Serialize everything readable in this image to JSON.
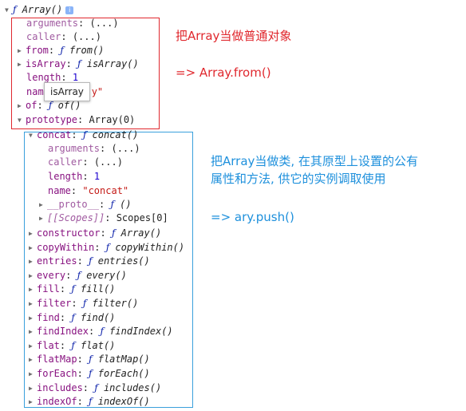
{
  "colors": {
    "red_annotation": "#e0282e",
    "blue_annotation": "#1e90dc",
    "key": "#881280",
    "func": "#0d22aa",
    "number": "#1c00cf",
    "string": "#c41a16"
  },
  "root": {
    "f": "ƒ",
    "name": "Array()",
    "info_icon": "i"
  },
  "red_group": {
    "arguments": {
      "key": "arguments",
      "value": "(...)"
    },
    "caller": {
      "key": "caller",
      "value": "(...)"
    },
    "from": {
      "key": "from",
      "f": "ƒ",
      "value": "from()"
    },
    "isArray": {
      "key": "isArray",
      "f": "ƒ",
      "value": "isArray()"
    },
    "length": {
      "key": "length",
      "value": "1"
    },
    "name": {
      "key": "nam",
      "value": "y\""
    },
    "of": {
      "key": "of",
      "f": "ƒ",
      "value": "of()"
    },
    "prototype": {
      "key": "prototype",
      "value": "Array(0)"
    }
  },
  "tooltip": "isArray",
  "concat": {
    "key": "concat",
    "f": "ƒ",
    "value": "concat()",
    "arguments": {
      "key": "arguments",
      "value": "(...)"
    },
    "caller": {
      "key": "caller",
      "value": "(...)"
    },
    "length": {
      "key": "length",
      "value": "1"
    },
    "name": {
      "key": "name",
      "value": "\"concat\""
    },
    "proto": {
      "key": "__proto__",
      "f": "ƒ",
      "value": "()"
    },
    "scopes": {
      "key": "[[Scopes]]",
      "value": "Scopes[0]"
    }
  },
  "methods": [
    {
      "key": "constructor",
      "f": "ƒ",
      "value": "Array()"
    },
    {
      "key": "copyWithin",
      "f": "ƒ",
      "value": "copyWithin()"
    },
    {
      "key": "entries",
      "f": "ƒ",
      "value": "entries()"
    },
    {
      "key": "every",
      "f": "ƒ",
      "value": "every()"
    },
    {
      "key": "fill",
      "f": "ƒ",
      "value": "fill()"
    },
    {
      "key": "filter",
      "f": "ƒ",
      "value": "filter()"
    },
    {
      "key": "find",
      "f": "ƒ",
      "value": "find()"
    },
    {
      "key": "findIndex",
      "f": "ƒ",
      "value": "findIndex()"
    },
    {
      "key": "flat",
      "f": "ƒ",
      "value": "flat()"
    },
    {
      "key": "flatMap",
      "f": "ƒ",
      "value": "flatMap()"
    },
    {
      "key": "forEach",
      "f": "ƒ",
      "value": "forEach()"
    },
    {
      "key": "includes",
      "f": "ƒ",
      "value": "includes()"
    },
    {
      "key": "indexOf",
      "f": "ƒ",
      "value": "indexOf()"
    }
  ],
  "notes": {
    "red_line1": "把Array当做普通对象",
    "red_line2": "=> Array.from()",
    "blue_line1": "把Array当做类, 在其原型上设置的公有",
    "blue_line2": "属性和方法, 供它的实例调取使用",
    "blue_line3": "=> ary.push()"
  }
}
